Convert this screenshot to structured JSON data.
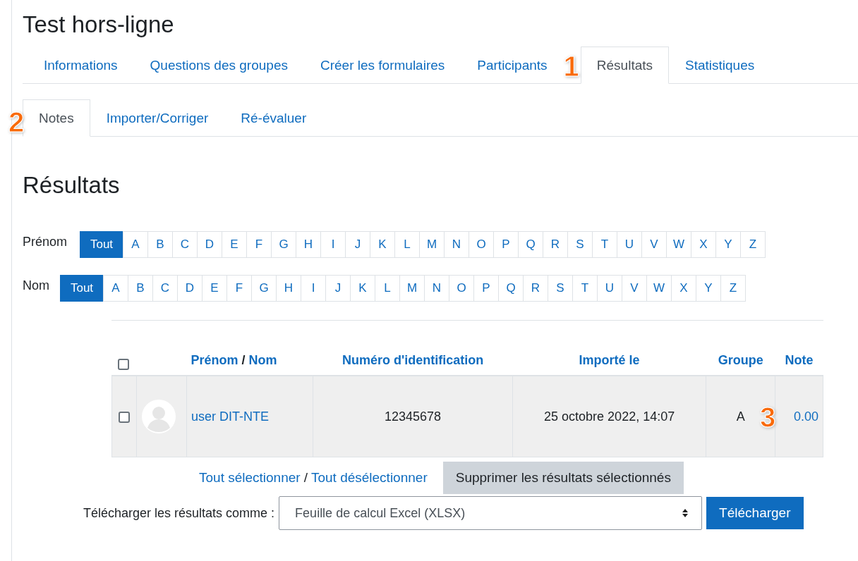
{
  "title": "Test hors-ligne",
  "tabs": [
    {
      "label": "Informations",
      "selected": false
    },
    {
      "label": "Questions des groupes",
      "selected": false
    },
    {
      "label": "Créer les formulaires",
      "selected": false
    },
    {
      "label": "Participants",
      "selected": false
    },
    {
      "label": "Résultats",
      "selected": true,
      "callout": "1"
    },
    {
      "label": "Statistiques",
      "selected": false
    }
  ],
  "subtabs": [
    {
      "label": "Notes",
      "selected": true,
      "callout": "2"
    },
    {
      "label": "Importer/Corriger",
      "selected": false
    },
    {
      "label": "Ré-évaluer",
      "selected": false
    }
  ],
  "heading": "Résultats",
  "filters": [
    {
      "label": "Prénom",
      "letters": [
        {
          "label": "Tout",
          "selected": true
        },
        {
          "label": "A",
          "selected": false
        },
        {
          "label": "B",
          "selected": false
        },
        {
          "label": "C",
          "selected": false
        },
        {
          "label": "D",
          "selected": false
        },
        {
          "label": "E",
          "selected": false
        },
        {
          "label": "F",
          "selected": false
        },
        {
          "label": "G",
          "selected": false
        },
        {
          "label": "H",
          "selected": false
        },
        {
          "label": "I",
          "selected": false
        },
        {
          "label": "J",
          "selected": false
        },
        {
          "label": "K",
          "selected": false
        },
        {
          "label": "L",
          "selected": false
        },
        {
          "label": "M",
          "selected": false
        },
        {
          "label": "N",
          "selected": false
        },
        {
          "label": "O",
          "selected": false
        },
        {
          "label": "P",
          "selected": false
        },
        {
          "label": "Q",
          "selected": false
        },
        {
          "label": "R",
          "selected": false
        },
        {
          "label": "S",
          "selected": false
        },
        {
          "label": "T",
          "selected": false
        },
        {
          "label": "U",
          "selected": false
        },
        {
          "label": "V",
          "selected": false
        },
        {
          "label": "W",
          "selected": false
        },
        {
          "label": "X",
          "selected": false
        },
        {
          "label": "Y",
          "selected": false
        },
        {
          "label": "Z",
          "selected": false
        }
      ]
    },
    {
      "label": "Nom",
      "letters": [
        {
          "label": "Tout",
          "selected": true
        },
        {
          "label": "A",
          "selected": false
        },
        {
          "label": "B",
          "selected": false
        },
        {
          "label": "C",
          "selected": false
        },
        {
          "label": "D",
          "selected": false
        },
        {
          "label": "E",
          "selected": false
        },
        {
          "label": "F",
          "selected": false
        },
        {
          "label": "G",
          "selected": false
        },
        {
          "label": "H",
          "selected": false
        },
        {
          "label": "I",
          "selected": false
        },
        {
          "label": "J",
          "selected": false
        },
        {
          "label": "K",
          "selected": false
        },
        {
          "label": "L",
          "selected": false
        },
        {
          "label": "M",
          "selected": false
        },
        {
          "label": "N",
          "selected": false
        },
        {
          "label": "O",
          "selected": false
        },
        {
          "label": "P",
          "selected": false
        },
        {
          "label": "Q",
          "selected": false
        },
        {
          "label": "R",
          "selected": false
        },
        {
          "label": "S",
          "selected": false
        },
        {
          "label": "T",
          "selected": false
        },
        {
          "label": "U",
          "selected": false
        },
        {
          "label": "V",
          "selected": false
        },
        {
          "label": "W",
          "selected": false
        },
        {
          "label": "X",
          "selected": false
        },
        {
          "label": "Y",
          "selected": false
        },
        {
          "label": "Z",
          "selected": false
        }
      ]
    }
  ],
  "table": {
    "header_checked": false,
    "columns": {
      "first_name": "Prénom",
      "separator": "/",
      "last_name": "Nom",
      "id": "Numéro d'identification",
      "imported": "Importé le",
      "group": "Groupe",
      "grade": "Note"
    },
    "rows": [
      {
        "checked": false,
        "name": "user DIT-NTE",
        "id": "12345678",
        "imported": "25 octobre 2022, 14:07",
        "group": "A",
        "grade": "0.00",
        "callout": "3"
      }
    ]
  },
  "select_all": "Tout sélectionner",
  "select_sep": "/",
  "deselect_all": "Tout désélectionner",
  "delete_button": "Supprimer les résultats sélectionnés",
  "download_label": "Télécharger les résultats comme :",
  "download_format": "Feuille de calcul Excel (XLSX)",
  "download_button": "Télécharger"
}
